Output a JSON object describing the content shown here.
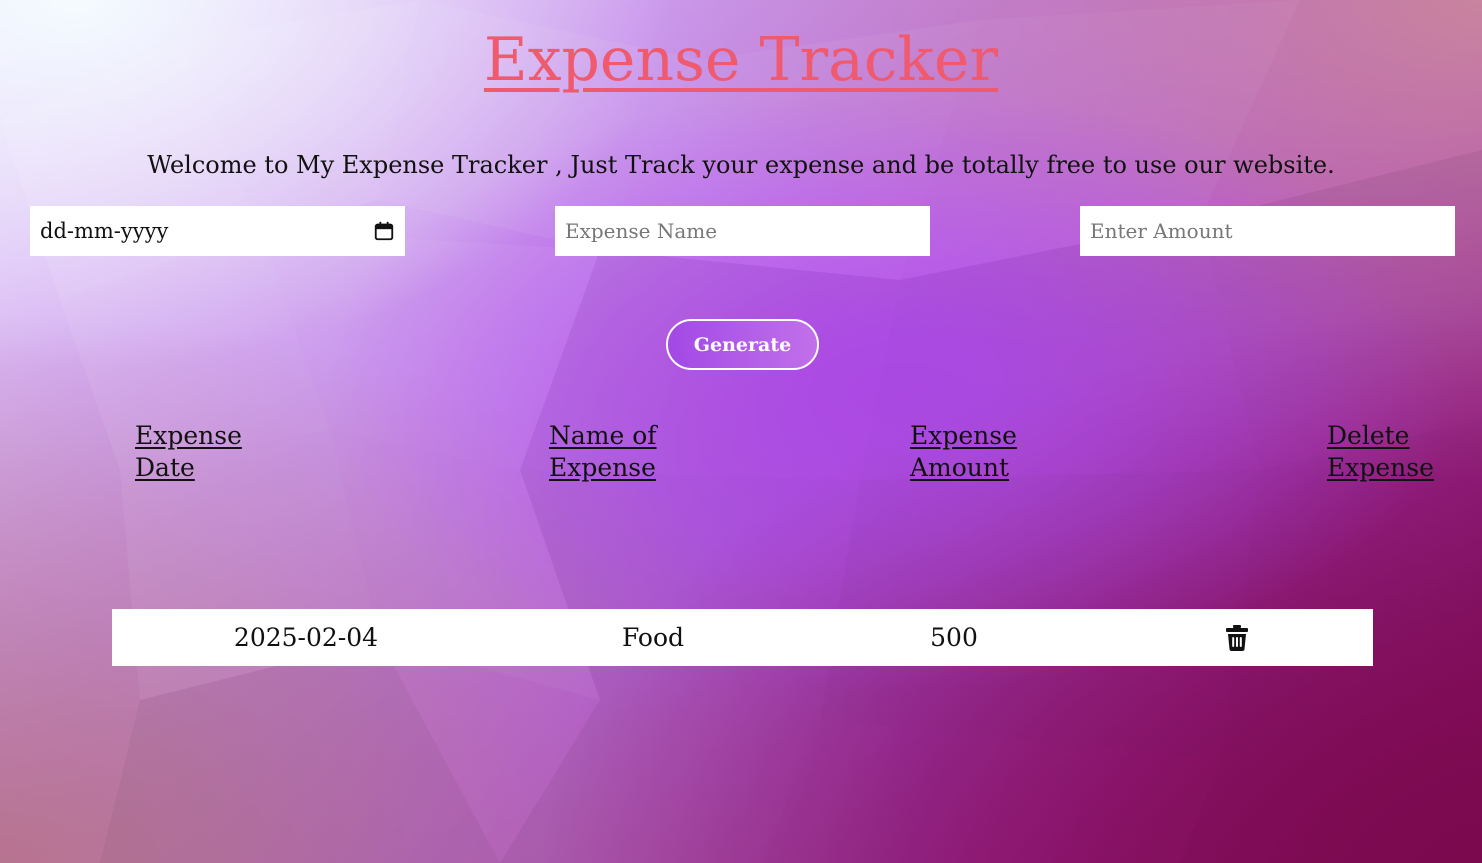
{
  "header": {
    "title": "Expense Tracker",
    "welcome": "Welcome to My Expense Tracker , Just Track your expense and be totally free to use our website."
  },
  "form": {
    "date_placeholder": "dd-mm-yyyy",
    "name_placeholder": "Expense Name",
    "amount_placeholder": "Enter Amount",
    "generate_label": "Generate"
  },
  "table": {
    "columns": [
      "Expense Date",
      "Name of Expense",
      "Expense Amount",
      "Delete Expense"
    ],
    "rows": [
      {
        "date": "2025-02-04",
        "name": "Food",
        "amount": "500",
        "delete_icon": "trash-icon"
      }
    ]
  },
  "colors": {
    "title": "#ef5a6e",
    "accent": "#a046e6"
  }
}
